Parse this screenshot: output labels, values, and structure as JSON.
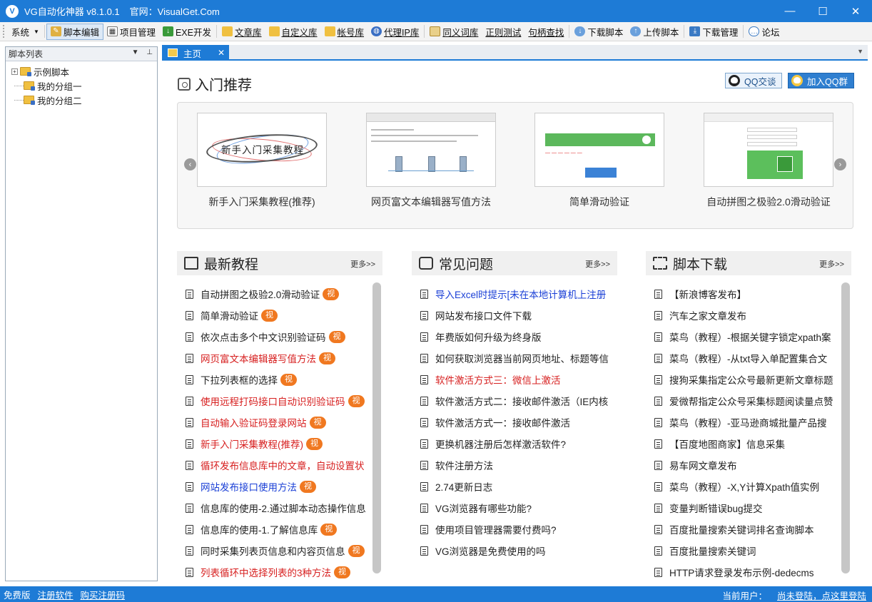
{
  "window": {
    "title": "VG自动化神器 v8.1.0.1",
    "website": "官网：VisualGet.Com",
    "minimize_glyph": "—",
    "maximize_glyph": "☐",
    "close_glyph": "✕"
  },
  "toolbar": {
    "system": "系统",
    "script_edit": "脚本编辑",
    "project_manage": "项目管理",
    "exe_dev": "EXE开发",
    "article_lib": "文章库",
    "custom_lib": "自定义库",
    "account_lib": "帐号库",
    "proxy_lib": "代理IP库",
    "synonym_lib": "同义词库",
    "regex_test": "正则测试",
    "handle_find": "句柄查找",
    "download_script": "下载脚本",
    "upload_script": "上传脚本",
    "download_manage": "下载管理",
    "forum": "论坛"
  },
  "leftpanel": {
    "title": "脚本列表",
    "items": [
      {
        "label": "示例脚本"
      },
      {
        "label": "我的分组一"
      },
      {
        "label": "我的分组二"
      }
    ]
  },
  "tabs": {
    "home": "主页"
  },
  "intro": {
    "title": "入门推荐",
    "qq_chat": "QQ交谈",
    "qq_group": "加入QQ群",
    "cards": [
      {
        "caption": "新手入门采集教程(推荐)",
        "thumb_text": "新手入门采集教程"
      },
      {
        "caption": "网页富文本编辑器写值方法"
      },
      {
        "caption": "简单滑动验证"
      },
      {
        "caption": "自动拼图之极验2.0滑动验证"
      }
    ]
  },
  "columns": {
    "more_label": "更多>>",
    "video_badge": "视",
    "tutorials": {
      "title": "最新教程",
      "items": [
        {
          "text": "自动拼图之极验2.0滑动验证",
          "color": "normal",
          "video": true
        },
        {
          "text": "简单滑动验证",
          "color": "normal",
          "video": true
        },
        {
          "text": "依次点击多个中文识别验证码",
          "color": "normal",
          "video": true
        },
        {
          "text": "网页富文本编辑器写值方法",
          "color": "red",
          "video": true
        },
        {
          "text": "下拉列表框的选择",
          "color": "normal",
          "video": true
        },
        {
          "text": "使用远程打码接口自动识别验证码",
          "color": "red",
          "video": true
        },
        {
          "text": "自动输入验证码登录网站",
          "color": "red",
          "video": true
        },
        {
          "text": "新手入门采集教程(推荐)",
          "color": "red",
          "video": true
        },
        {
          "text": "循环发布信息库中的文章，自动设置状",
          "color": "red",
          "video": false
        },
        {
          "text": "网站发布接口使用方法",
          "color": "blue",
          "video": true
        },
        {
          "text": "信息库的使用-2.通过脚本动态操作信息",
          "color": "normal",
          "video": false
        },
        {
          "text": "信息库的使用-1.了解信息库",
          "color": "normal",
          "video": true
        },
        {
          "text": "同时采集列表页信息和内容页信息",
          "color": "normal",
          "video": true
        },
        {
          "text": "列表循环中选择列表的3种方法",
          "color": "red",
          "video": true
        }
      ]
    },
    "faq": {
      "title": "常见问题",
      "items": [
        {
          "text": "导入Excel时提示[未在本地计算机上注册",
          "color": "blue"
        },
        {
          "text": "网站发布接口文件下载",
          "color": "normal"
        },
        {
          "text": "年费版如何升级为终身版",
          "color": "normal"
        },
        {
          "text": "如何获取浏览器当前网页地址、标题等信",
          "color": "normal"
        },
        {
          "text": "软件激活方式三：微信上激活",
          "color": "red"
        },
        {
          "text": "软件激活方式二：接收邮件激活（IE内核",
          "color": "normal"
        },
        {
          "text": "软件激活方式一：接收邮件激活",
          "color": "normal"
        },
        {
          "text": "更换机器注册后怎样激活软件?",
          "color": "normal"
        },
        {
          "text": "软件注册方法",
          "color": "normal"
        },
        {
          "text": "2.74更新日志",
          "color": "normal"
        },
        {
          "text": "VG浏览器有哪些功能?",
          "color": "normal"
        },
        {
          "text": "使用项目管理器需要付费吗?",
          "color": "normal"
        },
        {
          "text": "VG浏览器是免费使用的吗",
          "color": "normal"
        }
      ]
    },
    "downloads": {
      "title": "脚本下载",
      "items": [
        {
          "text": "【新浪博客发布】",
          "color": "normal"
        },
        {
          "text": "汽车之家文章发布",
          "color": "normal"
        },
        {
          "text": "菜鸟（教程）-根据关键字锁定xpath案",
          "color": "normal"
        },
        {
          "text": "菜鸟（教程）-从txt导入单配置集合文",
          "color": "normal"
        },
        {
          "text": "搜狗采集指定公众号最新更新文章标题",
          "color": "normal"
        },
        {
          "text": "爱微帮指定公众号采集标题阅读量点赞",
          "color": "normal"
        },
        {
          "text": "菜鸟（教程）-亚马逊商城批量产品搜",
          "color": "normal"
        },
        {
          "text": "【百度地图商家】信息采集",
          "color": "normal"
        },
        {
          "text": "易车网文章发布",
          "color": "normal"
        },
        {
          "text": "菜鸟（教程）-X,Y计算Xpath值实例",
          "color": "normal"
        },
        {
          "text": "变量判断错误bug提交",
          "color": "normal"
        },
        {
          "text": "百度批量搜索关键词排名查询脚本",
          "color": "normal"
        },
        {
          "text": "百度批量搜索关键词",
          "color": "normal"
        },
        {
          "text": "HTTP请求登录发布示例-dedecms",
          "color": "normal"
        }
      ]
    }
  },
  "statusbar": {
    "edition": "免费版",
    "register": "注册软件",
    "buy_code": "购买注册码",
    "current_user_label": "当前用户：",
    "login_link": "尚未登陆，点这里登陆"
  },
  "colors": {
    "accent": "#1e7bd6",
    "badge": "#f07820",
    "red_link": "#d72020",
    "blue_link": "#1a3fd6"
  }
}
